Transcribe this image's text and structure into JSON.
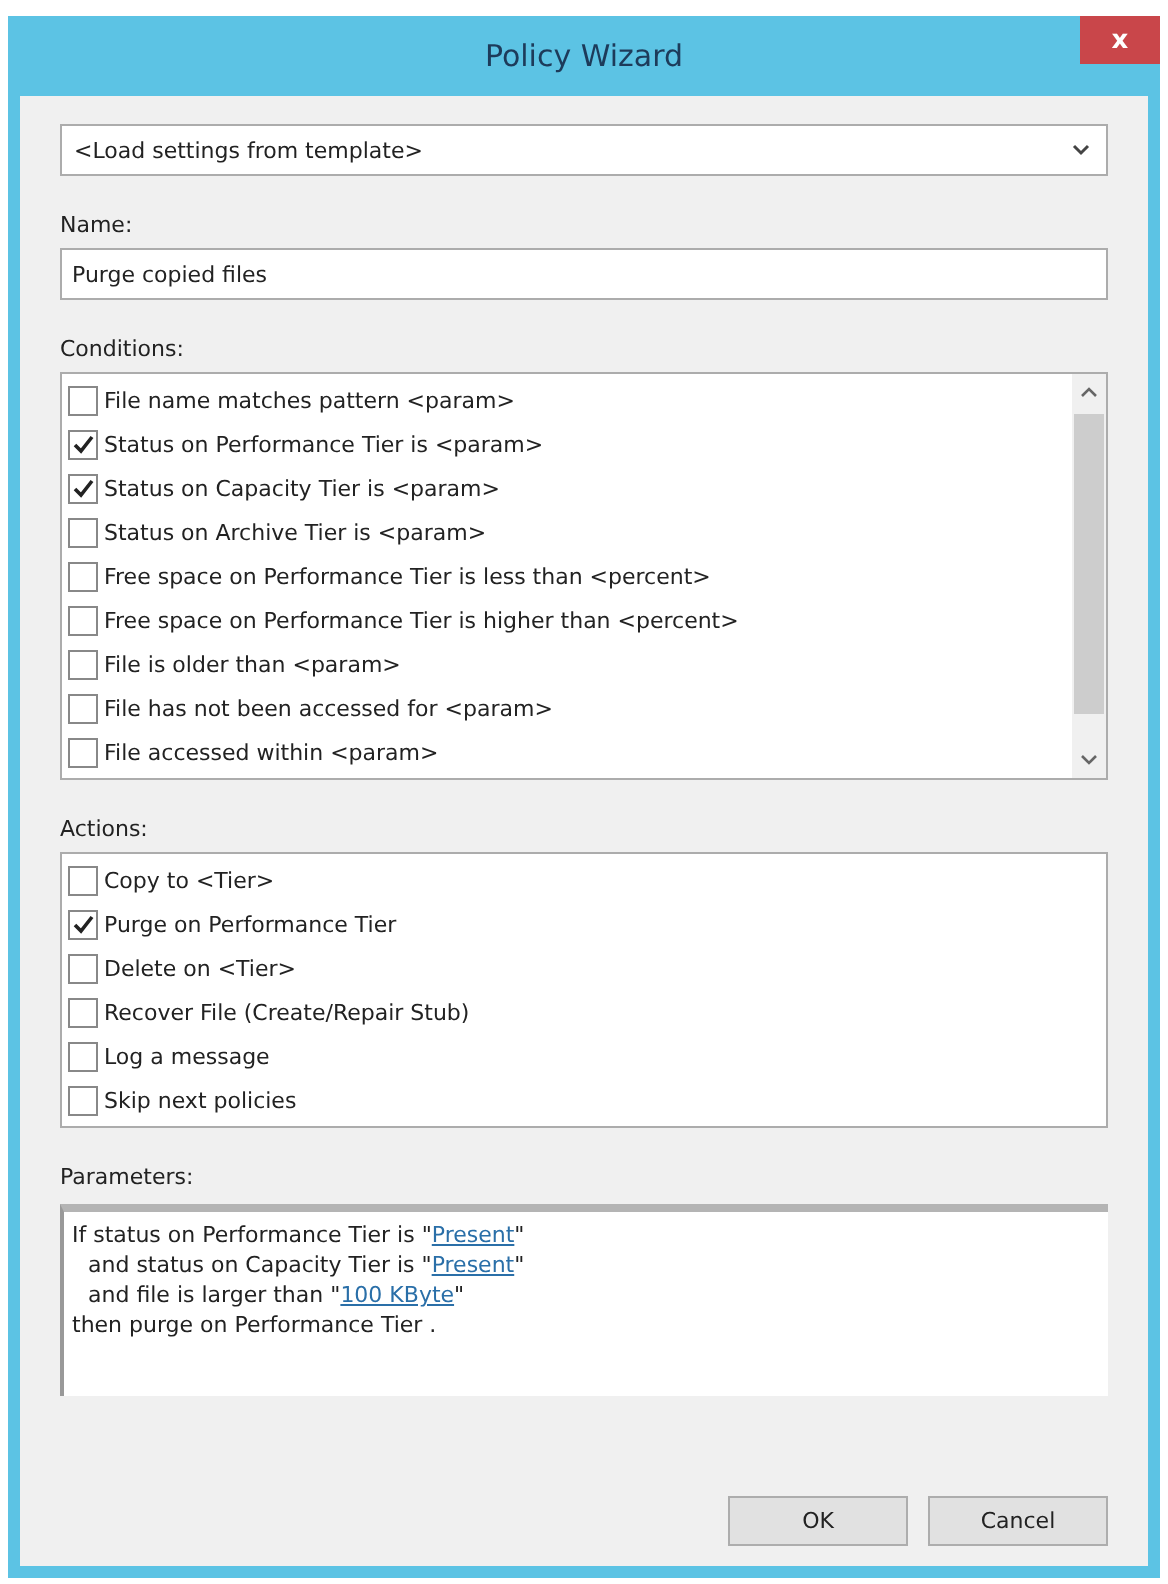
{
  "window": {
    "title": "Policy Wizard",
    "close": "x"
  },
  "template": {
    "value": "<Load settings from template>"
  },
  "name": {
    "label": "Name:",
    "value": "Purge copied files"
  },
  "conditions": {
    "label": "Conditions:",
    "items": [
      {
        "label": "File name matches pattern <param>",
        "checked": false
      },
      {
        "label": "Status on Performance Tier is <param>",
        "checked": true
      },
      {
        "label": "Status on Capacity Tier is <param>",
        "checked": true
      },
      {
        "label": "Status on Archive Tier is <param>",
        "checked": false
      },
      {
        "label": "Free space on Performance Tier is less than <percent>",
        "checked": false
      },
      {
        "label": "Free space on Performance Tier is higher than <percent>",
        "checked": false
      },
      {
        "label": "File is older than <param>",
        "checked": false
      },
      {
        "label": "File has not been accessed for <param>",
        "checked": false
      },
      {
        "label": "File accessed within <param>",
        "checked": false
      }
    ]
  },
  "actions": {
    "label": "Actions:",
    "items": [
      {
        "label": "Copy to <Tier>",
        "checked": false
      },
      {
        "label": "Purge on Performance Tier",
        "checked": true
      },
      {
        "label": "Delete on <Tier>",
        "checked": false
      },
      {
        "label": "Recover File (Create/Repair Stub)",
        "checked": false
      },
      {
        "label": "Log a message",
        "checked": false
      },
      {
        "label": "Skip next policies",
        "checked": false
      }
    ]
  },
  "parameters": {
    "label": "Parameters:",
    "lines": [
      [
        {
          "kind": "text",
          "text": "If status on Performance Tier is \""
        },
        {
          "kind": "link",
          "text": "Present"
        },
        {
          "kind": "text",
          "text": "\""
        }
      ],
      [
        {
          "kind": "text",
          "text": "and status on Capacity Tier is \""
        },
        {
          "kind": "link",
          "text": "Present"
        },
        {
          "kind": "text",
          "text": "\""
        }
      ],
      [
        {
          "kind": "text",
          "text": "and file is larger than \""
        },
        {
          "kind": "link",
          "text": "100 KByte"
        },
        {
          "kind": "text",
          "text": "\""
        }
      ],
      [
        {
          "kind": "text",
          "text": "then purge on Performance Tier ."
        }
      ]
    ]
  },
  "buttons": [
    "OK",
    "Cancel"
  ]
}
